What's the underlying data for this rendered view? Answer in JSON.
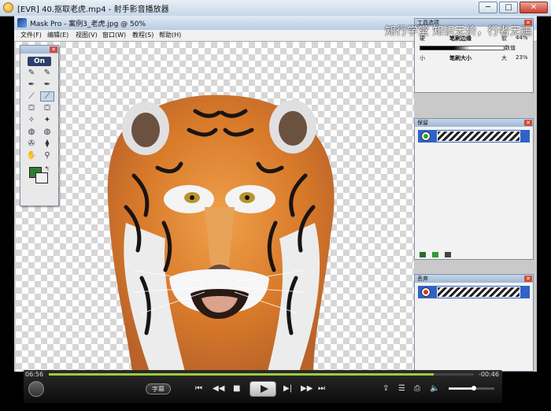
{
  "outer_window": {
    "title": "[EVR] 40.抠取老虎.mp4 - 射手影音播放器",
    "min_label": "─",
    "max_label": "□",
    "close_label": "✕"
  },
  "maskpro": {
    "title": "Mask Pro - 案例3_老虎.jpg @ 50%",
    "menu": [
      "文件(F)",
      "编辑(E)",
      "视图(V)",
      "窗口(W)",
      "教程(S)",
      "帮助(H)"
    ],
    "toolbox_logo": "On"
  },
  "watermark": "知行学堂 知识无价，行者无疆",
  "brush_panel": {
    "title": "工具选项",
    "hard_label": "硬",
    "edge_label": "笔刷边缘",
    "soft_label": "软",
    "edge_value": "44%",
    "value_label": "数值",
    "small_label": "小",
    "size_label": "笔刷大小",
    "big_label": "大",
    "size_value": "23%"
  },
  "keep_panel": {
    "title": "保留",
    "eye_color": "#2e9e2e"
  },
  "drop_panel": {
    "title": "丢弃",
    "eye_color": "#d23a20"
  },
  "player": {
    "current_time": "06:56",
    "remaining_time": "-00:46",
    "progress": 0.905,
    "volume": 0.55,
    "subtitle_label": "字幕",
    "accent_color": "#9ccc3c"
  }
}
